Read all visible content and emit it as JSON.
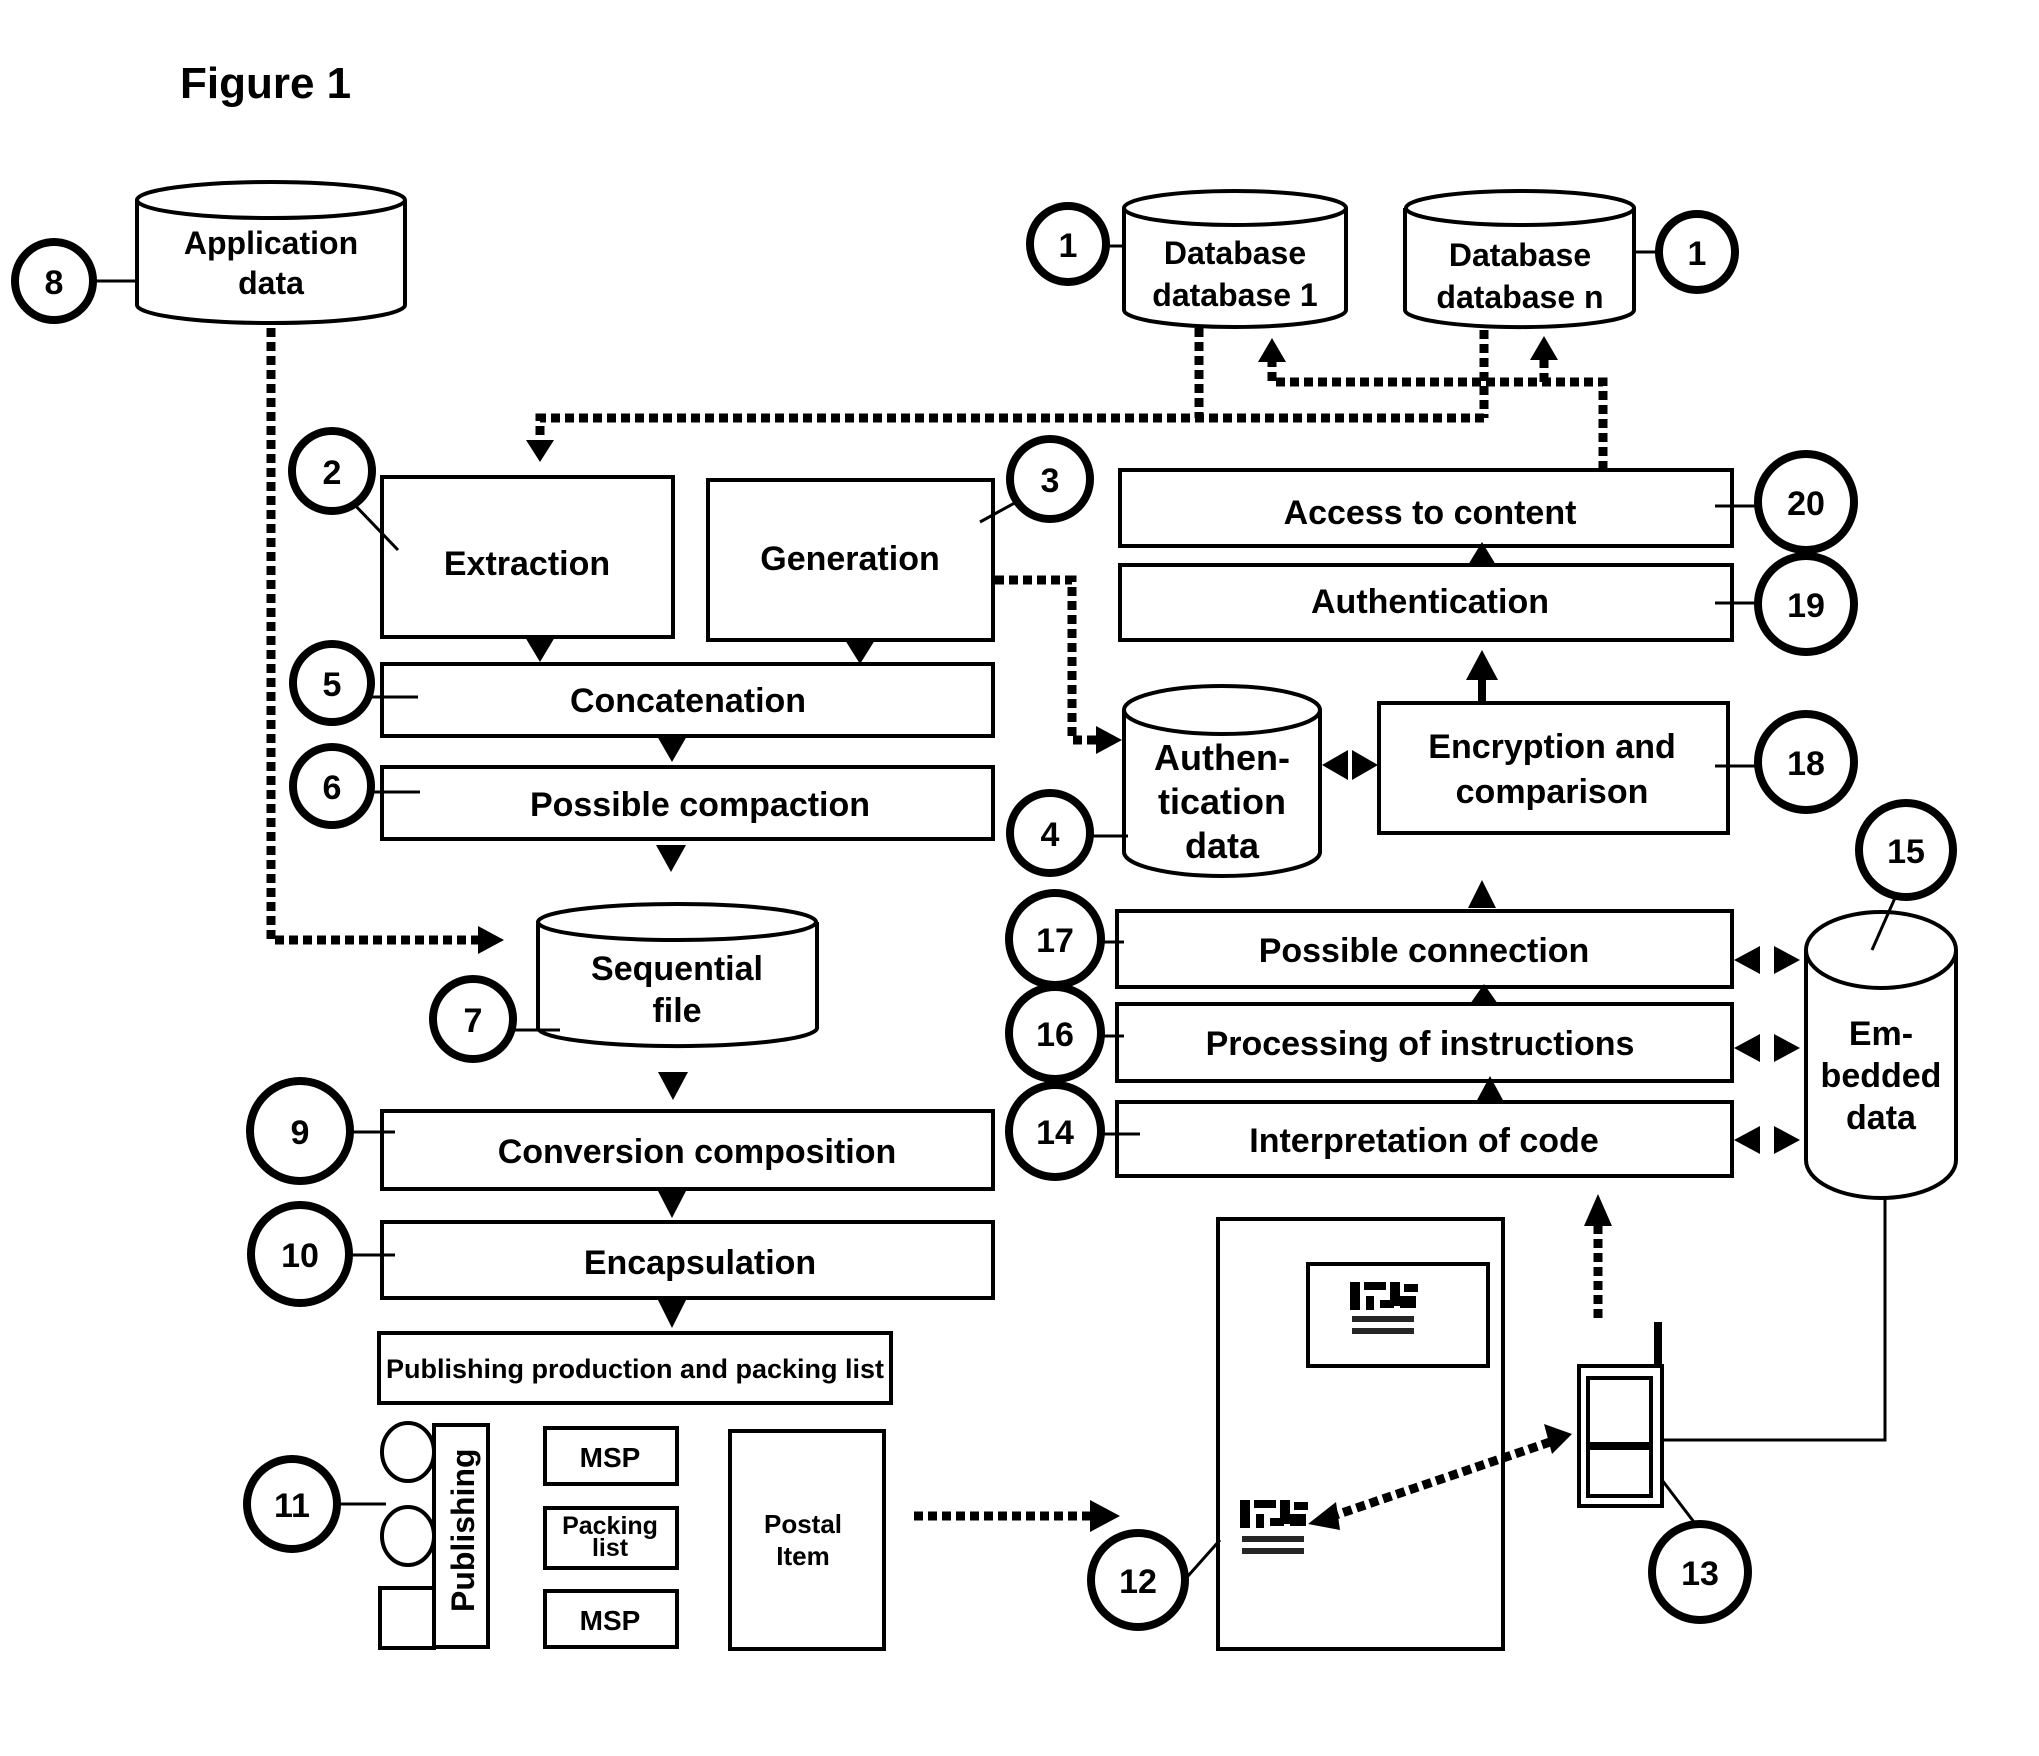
{
  "figure": {
    "title": "Figure 1"
  },
  "databases": {
    "application": {
      "line1": "Application",
      "line2": "data",
      "ref": "8"
    },
    "db1": {
      "line1": "Database",
      "line2": "database 1",
      "ref": "1"
    },
    "dbn": {
      "line1": "Database",
      "line2": "database n",
      "ref": "1"
    },
    "auth_data": {
      "line1": "Authen-",
      "line2": "tication",
      "line3": "data",
      "ref": "4"
    },
    "sequential": {
      "line1": "Sequential",
      "line2": "file",
      "ref": "7"
    },
    "embedded": {
      "line1": "Em-",
      "line2": "bedded",
      "line3": "data",
      "ref": "15"
    }
  },
  "steps": {
    "extraction": {
      "label": "Extraction",
      "ref": "2"
    },
    "generation": {
      "label": "Generation",
      "ref": "3"
    },
    "concatenation": {
      "label": "Concatenation",
      "ref": "5"
    },
    "compaction": {
      "label": "Possible compaction",
      "ref": "6"
    },
    "conversion": {
      "label": "Conversion composition",
      "ref": "9"
    },
    "encapsulation": {
      "label": "Encapsulation",
      "ref": "10"
    },
    "publishing_list": {
      "label": "Publishing production and packing list"
    },
    "access": {
      "label": "Access to content",
      "ref": "20"
    },
    "authentication": {
      "label": "Authentication",
      "ref": "19"
    },
    "encryption": {
      "line1": "Encryption and",
      "line2": "comparison",
      "ref": "18"
    },
    "connection": {
      "label": "Possible connection",
      "ref": "17"
    },
    "processing": {
      "label": "Processing of instructions",
      "ref": "16"
    },
    "interpretation": {
      "label": "Interpretation of code",
      "ref": "14"
    }
  },
  "publishing": {
    "ref": "11",
    "publishing_label": "Publishing",
    "msp1": "MSP",
    "packing_line1": "Packing",
    "packing_line2": "list",
    "msp2": "MSP",
    "postal_line1": "Postal",
    "postal_line2": "Item"
  },
  "delivery": {
    "postal_item_ref": "12",
    "phone_ref": "13"
  }
}
